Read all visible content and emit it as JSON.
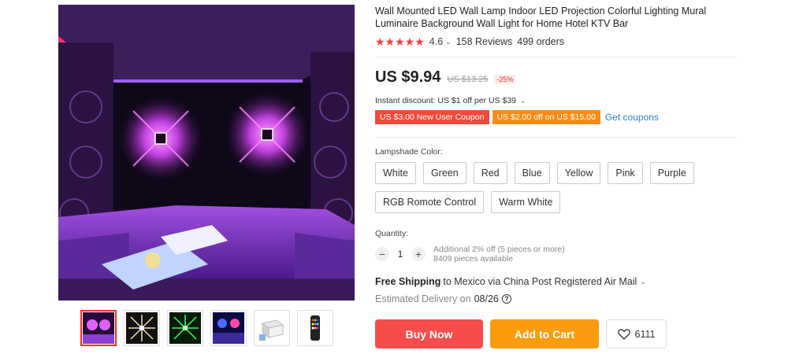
{
  "product": {
    "title": "Wall Mounted LED Wall Lamp Indoor LED Projection Colorful Lighting Mural Luminaire Background Wall Light for Home Hotel KTV Bar",
    "rating": "4.6",
    "reviews": "158 Reviews",
    "orders": "499 orders",
    "price": "US $9.94",
    "old_price": "US $13.25",
    "discount": "-25%",
    "instant_discount": "Instant discount: US $1 off per US $39",
    "coupons": [
      {
        "label": "US $3.00 New User Coupon"
      },
      {
        "label": "US $2.00 off on US $15.00"
      }
    ],
    "get_coupons": "Get coupons",
    "color_label": "Lampshade Color:",
    "colors": [
      "White",
      "Green",
      "Red",
      "Blue",
      "Yellow",
      "Pink",
      "Purple",
      "RGB Romote Control",
      "Warm White"
    ],
    "quantity_label": "Quantity:",
    "quantity": "1",
    "quantity_note": "Additional 2% off (5 pieces or more)",
    "stock": "8409 pieces available",
    "shipping_bold": "Free Shipping",
    "shipping_rest": "to Mexico via China Post Registered Air Mail",
    "delivery_label": "Estimated Delivery on",
    "delivery_date": "08/26",
    "buy_now": "Buy Now",
    "add_to_cart": "Add to Cart",
    "wishlist_count": "6111"
  },
  "colors": {
    "accent_red": "#f74c4c",
    "accent_orange": "#fa9c0e",
    "link_blue": "#2e7fd6",
    "star": "#f04040"
  }
}
